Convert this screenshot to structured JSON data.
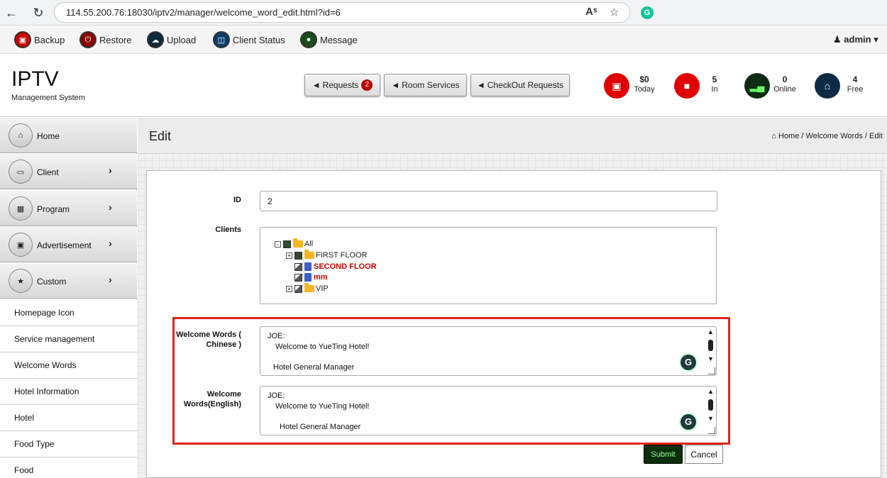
{
  "browser": {
    "url": "114.55.200.76:18030/iptv2/manager/welcome_word_edit.html?id=6",
    "read_aloud": "Aˢ"
  },
  "toolbar": {
    "backup": "Backup",
    "restore": "Restore",
    "upload": "Upload",
    "client_status": "Client Status",
    "message": "Message",
    "user": "admin"
  },
  "header": {
    "title": "IPTV",
    "subtitle": "Management System",
    "requests_label": "Requests",
    "requests_count": "2",
    "room_services": "Room Services",
    "checkout_requests": "CheckOut Requests",
    "stats": [
      {
        "value": "$0",
        "label": "Today",
        "color": "#e00000"
      },
      {
        "value": "5",
        "label": "In",
        "color": "#e00000"
      },
      {
        "value": "0",
        "label": "Online",
        "color": "#0d2b12"
      },
      {
        "value": "4",
        "label": "Free",
        "color": "#0d2b44"
      }
    ]
  },
  "sidebar": {
    "main_items": [
      {
        "label": "Home"
      },
      {
        "label": "Client"
      },
      {
        "label": "Program"
      },
      {
        "label": "Advertisement"
      },
      {
        "label": "Custom"
      }
    ],
    "sub_items": [
      {
        "label": "Homepage Icon"
      },
      {
        "label": "Service management"
      },
      {
        "label": "Welcome Words"
      },
      {
        "label": "Hotel Information"
      },
      {
        "label": "Hotel"
      },
      {
        "label": "Food Type"
      },
      {
        "label": "Food"
      }
    ]
  },
  "page": {
    "title": "Edit",
    "breadcrumb": {
      "home": "Home",
      "sep": "/",
      "section": "Welcome Words",
      "current": "Edit"
    }
  },
  "form": {
    "id_label": "ID",
    "id_value": "2",
    "clients_label": "Clients",
    "tree": {
      "root": "All",
      "nodes": [
        "FIRST FLOOR",
        "SECOND FLOOR",
        "mm",
        "VIP"
      ]
    },
    "chinese_label_1": "Welcome Words (",
    "chinese_label_2": "Chinese )",
    "chinese_text": {
      "line1": "JOE:",
      "line2": "Welcome to YueTing Hotel!",
      "line3": "Hotel General Manager"
    },
    "english_label_1": "Welcome",
    "english_label_2": "Words(English)",
    "english_text": {
      "line1": "JOE:",
      "line2": "Welcome to YueTing Hotel!",
      "line3": "Hotel General Manager"
    },
    "submit": "Submit",
    "cancel": "Cancel"
  },
  "colors": {
    "highlight": "#e1251b",
    "submit_bg": "#0b2e0b"
  }
}
